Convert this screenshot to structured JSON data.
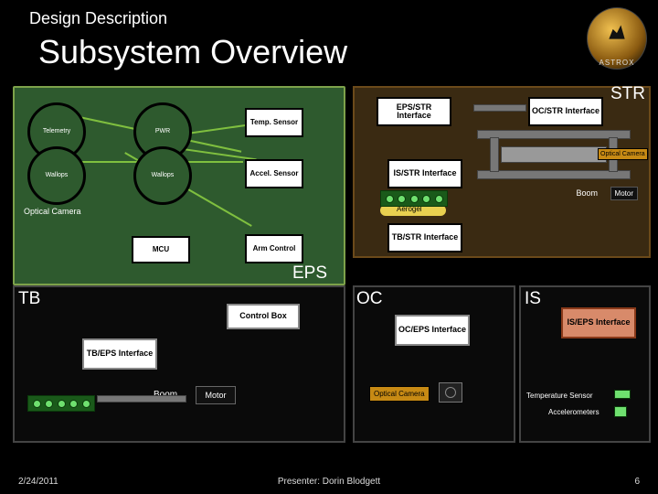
{
  "header": {
    "suptitle": "Design Description",
    "title": "Subsystem Overview",
    "brand": "ASTROX"
  },
  "eps": {
    "label": "EPS",
    "telemetry": "Telemetry",
    "pwr": "PWR",
    "wallops_l": "Wallops",
    "wallops_r": "Wallops",
    "temp_sensor": "Temp. Sensor",
    "accel_sensor": "Accel. Sensor",
    "optical_camera": "Optical Camera",
    "mcu": "MCU",
    "arm_control": "Arm Control"
  },
  "str": {
    "label": "STR",
    "eps_iface": "EPS/STR Interface",
    "oc_iface": "OC/STR Interface",
    "is_iface": "IS/STR Interface",
    "tb_iface": "TB/STR Interface",
    "optical_camera": "Optical Camera",
    "aerogel": "Aerogel",
    "boom": "Boom",
    "motor": "Motor"
  },
  "tb": {
    "label": "TB",
    "control_box": "Control Box",
    "tb_eps_iface": "TB/EPS Interface",
    "boom": "Boom",
    "motor": "Motor"
  },
  "oc": {
    "label": "OC",
    "oc_eps_iface": "OC/EPS Interface",
    "optical_camera": "Optical Camera"
  },
  "is": {
    "label": "IS",
    "is_eps_iface": "IS/EPS Interface",
    "temp_sensor": "Temperature Sensor",
    "accel": "Accelerometers"
  },
  "footer": {
    "date": "2/24/2011",
    "presenter": "Presenter: Dorin Blodgett",
    "page": "6"
  }
}
